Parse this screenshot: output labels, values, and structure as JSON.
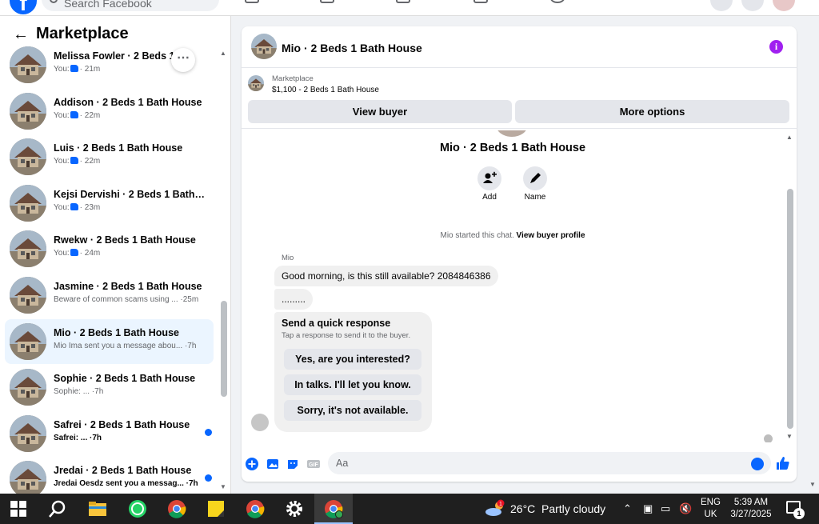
{
  "topbar": {
    "search_placeholder": "Search Facebook",
    "logo": "f"
  },
  "sidebar": {
    "title": "Marketplace",
    "conversations": [
      {
        "name": "Melissa Fowler · 2 Beds 1 Ba",
        "prefix": "You:",
        "time": "21m",
        "liked": true
      },
      {
        "name": "Addison · 2 Beds 1 Bath House",
        "prefix": "You:",
        "time": "22m",
        "liked": true
      },
      {
        "name": "Luis · 2 Beds 1 Bath House",
        "prefix": "You:",
        "time": "22m",
        "liked": true
      },
      {
        "name": "Kejsi Dervishi · 2 Beds 1 Bath H...",
        "prefix": "You:",
        "time": "23m",
        "liked": true
      },
      {
        "name": "Rwekw · 2 Beds 1 Bath House",
        "prefix": "You:",
        "time": "24m",
        "liked": true
      },
      {
        "name": "Jasmine · 2 Beds 1 Bath House",
        "preview": "Beware of common scams using ... ·25m"
      },
      {
        "name": "Mio · 2 Beds 1 Bath House",
        "preview": "Mio Ima sent you a message abou... ·7h",
        "active": true
      },
      {
        "name": "Sophie · 2 Beds 1 Bath House",
        "preview": "Sophie: ... ·7h"
      },
      {
        "name": "Safrei · 2 Beds 1 Bath House",
        "preview": "Safrei: ... ·7h",
        "unread": true
      },
      {
        "name": "Jredai · 2 Beds 1 Bath House",
        "preview": "Jredai Oesdz sent you a messag... ·7h",
        "unread": true
      }
    ]
  },
  "chat": {
    "title": "Mio · 2 Beds 1 Bath House",
    "listing": {
      "label": "Marketplace",
      "price_title": "$1,100 - 2 Beds 1 Bath House"
    },
    "view_buyer": "View buyer",
    "more_options": "More options",
    "center_title": "Mio · 2 Beds 1 Bath House",
    "actions": {
      "add": "Add",
      "name": "Name"
    },
    "started_text": "Mio started this chat.",
    "view_profile": "View buyer profile",
    "sender": "Mio",
    "messages": [
      "Good morning, is this still available? 2084846386",
      "........."
    ],
    "quick_response": {
      "title": "Send a quick response",
      "subtitle": "Tap a response to send it to the buyer.",
      "options": [
        "Yes, are you interested?",
        "In talks. I'll let you know.",
        "Sorry, it's not available."
      ]
    },
    "composer_placeholder": "Aa",
    "gif_label": "GIF"
  },
  "taskbar": {
    "temperature": "26°C",
    "weather": "Partly cloudy",
    "lang_top": "ENG",
    "lang_bottom": "UK",
    "time": "5:39 AM",
    "date": "3/27/2025",
    "notifications": "1",
    "weather_badge": "1"
  },
  "colors": {
    "accent": "#0866ff",
    "info": "#a020f0",
    "taskbar": "#1f1f1f"
  }
}
